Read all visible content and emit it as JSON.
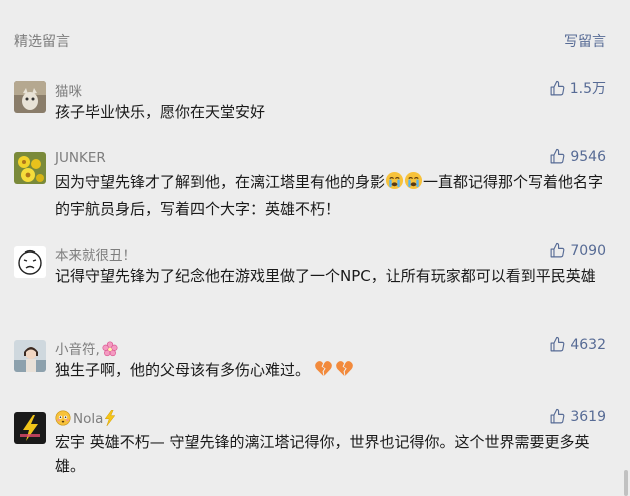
{
  "header": {
    "title": "精选留言",
    "write_label": "写留言"
  },
  "colors": {
    "background": "#ededed",
    "name": "#7d7d7d",
    "accent": "#576b95",
    "text": "#191919"
  },
  "comments": [
    {
      "name": "猫咪",
      "likes": "1.5万",
      "text": "孩子毕业快乐，愿你在天堂安好",
      "avatar_icon": "cat-photo-avatar"
    },
    {
      "name": "JUNKER",
      "likes": "9546",
      "text_a": "因为守望先锋才了解到他，在漓江塔里有他的身影",
      "text_b": "一直都记得那个写着他名字的宇航员身后，写着四个大字：英雄不朽！",
      "avatar_icon": "flower-avatar",
      "inline_emoji": "crying-emoji"
    },
    {
      "name": "本来就很丑！",
      "likes": "7090",
      "text": "记得守望先锋为了纪念他在游戏里做了一个NPC，让所有玩家都可以看到平民英雄",
      "avatar_icon": "doodle-face-avatar"
    },
    {
      "name": "小音符,",
      "likes": "4632",
      "text": "独生子啊，他的父母该有多伤心难过。",
      "avatar_icon": "girl-photo-avatar",
      "name_emoji": "cherry-blossom-emoji",
      "inline_emoji": "broken-heart-emoji"
    },
    {
      "name": "Nola",
      "likes": "3619",
      "text": "宏宇 英雄不朽— 守望先锋的漓江塔记得你，世界也记得你。这个世界需要更多英雄。",
      "avatar_icon": "lightning-logo-avatar",
      "name_prefix_emoji": "flushed-face-emoji",
      "name_suffix_emoji": "lightning-emoji"
    }
  ]
}
